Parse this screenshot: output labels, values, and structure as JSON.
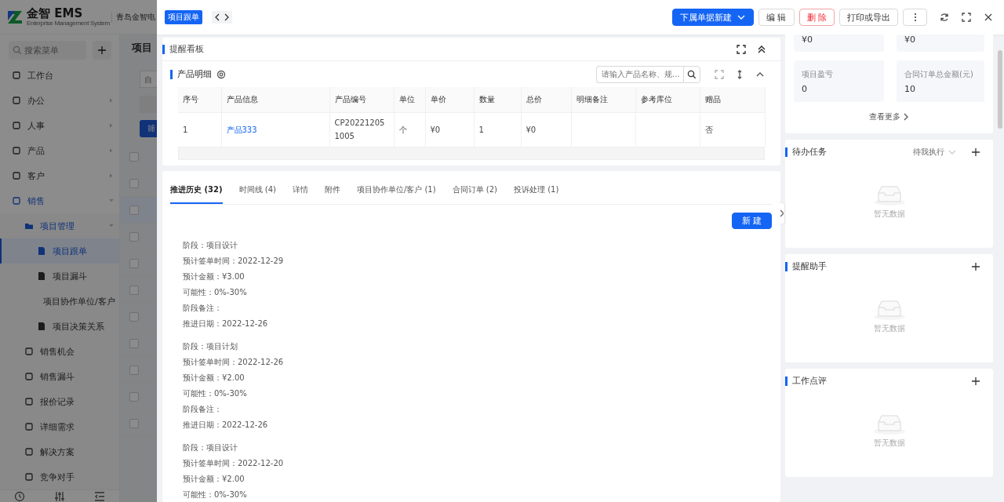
{
  "sidebar": {
    "logo": {
      "brand": "金智 EMS",
      "tagline": "Enterprise Management System"
    },
    "company": "青岛金智电",
    "search": {
      "placeholder": "搜索菜单"
    },
    "items": [
      {
        "label": "工作台",
        "selected": false
      },
      {
        "label": "办公",
        "selected": false,
        "expanded": false
      },
      {
        "label": "人事",
        "selected": false,
        "expanded": false
      },
      {
        "label": "产品",
        "selected": false,
        "expanded": false
      },
      {
        "label": "客户",
        "selected": false,
        "expanded": false
      },
      {
        "label": "销售",
        "selected": false,
        "expanded": true,
        "children": [
          {
            "label": "项目管理",
            "selected": false,
            "expanded": true,
            "children": [
              {
                "label": "项目跟单",
                "selected": true
              },
              {
                "label": "项目漏斗",
                "selected": false
              },
              {
                "label": "项目协作单位/客户",
                "selected": false
              },
              {
                "label": "项目决策关系",
                "selected": false
              }
            ]
          },
          {
            "label": "销售机会",
            "selected": false
          },
          {
            "label": "销售漏斗",
            "selected": false
          },
          {
            "label": "报价记录",
            "selected": false
          },
          {
            "label": "详细需求",
            "selected": false
          },
          {
            "label": "解决方案",
            "selected": false
          },
          {
            "label": "竞争对手",
            "selected": false
          }
        ]
      }
    ]
  },
  "background_page": {
    "title": "项目",
    "filter_placeholder": "自",
    "filter_button": "筛",
    "rows": [
      {
        "checked": false
      },
      {
        "checked": false
      },
      {
        "checked": false
      },
      {
        "checked": false
      },
      {
        "checked": false
      },
      {
        "checked": false
      },
      {
        "checked": false
      },
      {
        "checked": false
      },
      {
        "checked": false
      },
      {
        "checked": false
      },
      {
        "checked": false
      }
    ]
  },
  "drawer": {
    "tag": "项目跟单",
    "actions": [
      {
        "label": "下属单据新建",
        "kind": "primary"
      },
      {
        "label": "编 辑",
        "kind": "default"
      },
      {
        "label": "删 除",
        "kind": "danger"
      },
      {
        "label": "打印或导出",
        "kind": "default"
      }
    ],
    "reminder_board": {
      "title": "提醒看板",
      "products": {
        "title": "产品明细",
        "search": {
          "placeholder": "请输入产品名称、规..."
        },
        "columns": [
          {
            "label": "序号",
            "kind": "text"
          },
          {
            "label": "产品信息",
            "kind": "link"
          },
          {
            "label": "产品编号",
            "kind": "text"
          },
          {
            "label": "单位",
            "kind": "text"
          },
          {
            "label": "单价",
            "kind": "text"
          },
          {
            "label": "数量",
            "kind": "text"
          },
          {
            "label": "总价",
            "kind": "text"
          },
          {
            "label": "明细备注",
            "kind": "text"
          },
          {
            "label": "参考库位",
            "kind": "text"
          },
          {
            "label": "赠品",
            "kind": "text"
          }
        ],
        "rows": [
          [
            "1",
            "产品333",
            "CP202212051005",
            "个",
            "¥0",
            "1",
            "¥0",
            null,
            null,
            "否"
          ]
        ]
      }
    },
    "tabs": [
      {
        "label": "推进历史 (32)",
        "selected": true
      },
      {
        "label": "时间线 (4)",
        "selected": false
      },
      {
        "label": "详情",
        "selected": false
      },
      {
        "label": "附件",
        "selected": false
      },
      {
        "label": "项目协作单位/客户 (1)",
        "selected": false
      },
      {
        "label": "合同订单 (2)",
        "selected": false
      },
      {
        "label": "投诉处理 (1)",
        "selected": false
      }
    ],
    "new_button": "新 建",
    "history": [
      {
        "lines": [
          "阶段：项目设计",
          "预计签单时间：2022-12-29",
          "预计金额：¥3.00",
          "可能性：0%-30%",
          "阶段备注：",
          "推进日期：2022-12-26"
        ]
      },
      {
        "lines": [
          "阶段：项目计划",
          "预计签单时间：2022-12-26",
          "预计金额：¥2.00",
          "可能性：0%-30%",
          "阶段备注：",
          "推进日期：2022-12-26"
        ]
      },
      {
        "lines": [
          "阶段：项目设计",
          "预计签单时间：2022-12-20",
          "预计金额：¥2.00",
          "可能性：0%-30%"
        ]
      }
    ],
    "stats": [
      {
        "value": "¥0"
      },
      {
        "value": "¥0"
      },
      {
        "label": "项目盈亏",
        "value": "0"
      },
      {
        "label": "合同订单总金额(元)",
        "value": "10"
      }
    ],
    "see_more": "查看更多",
    "panels": [
      {
        "title": "待办任务",
        "filter": "待我执行",
        "empty_text": "暂无数据"
      },
      {
        "title": "提醒助手",
        "empty_text": "暂无数据"
      },
      {
        "title": "工作点评",
        "empty_text": "暂无数据"
      }
    ]
  }
}
